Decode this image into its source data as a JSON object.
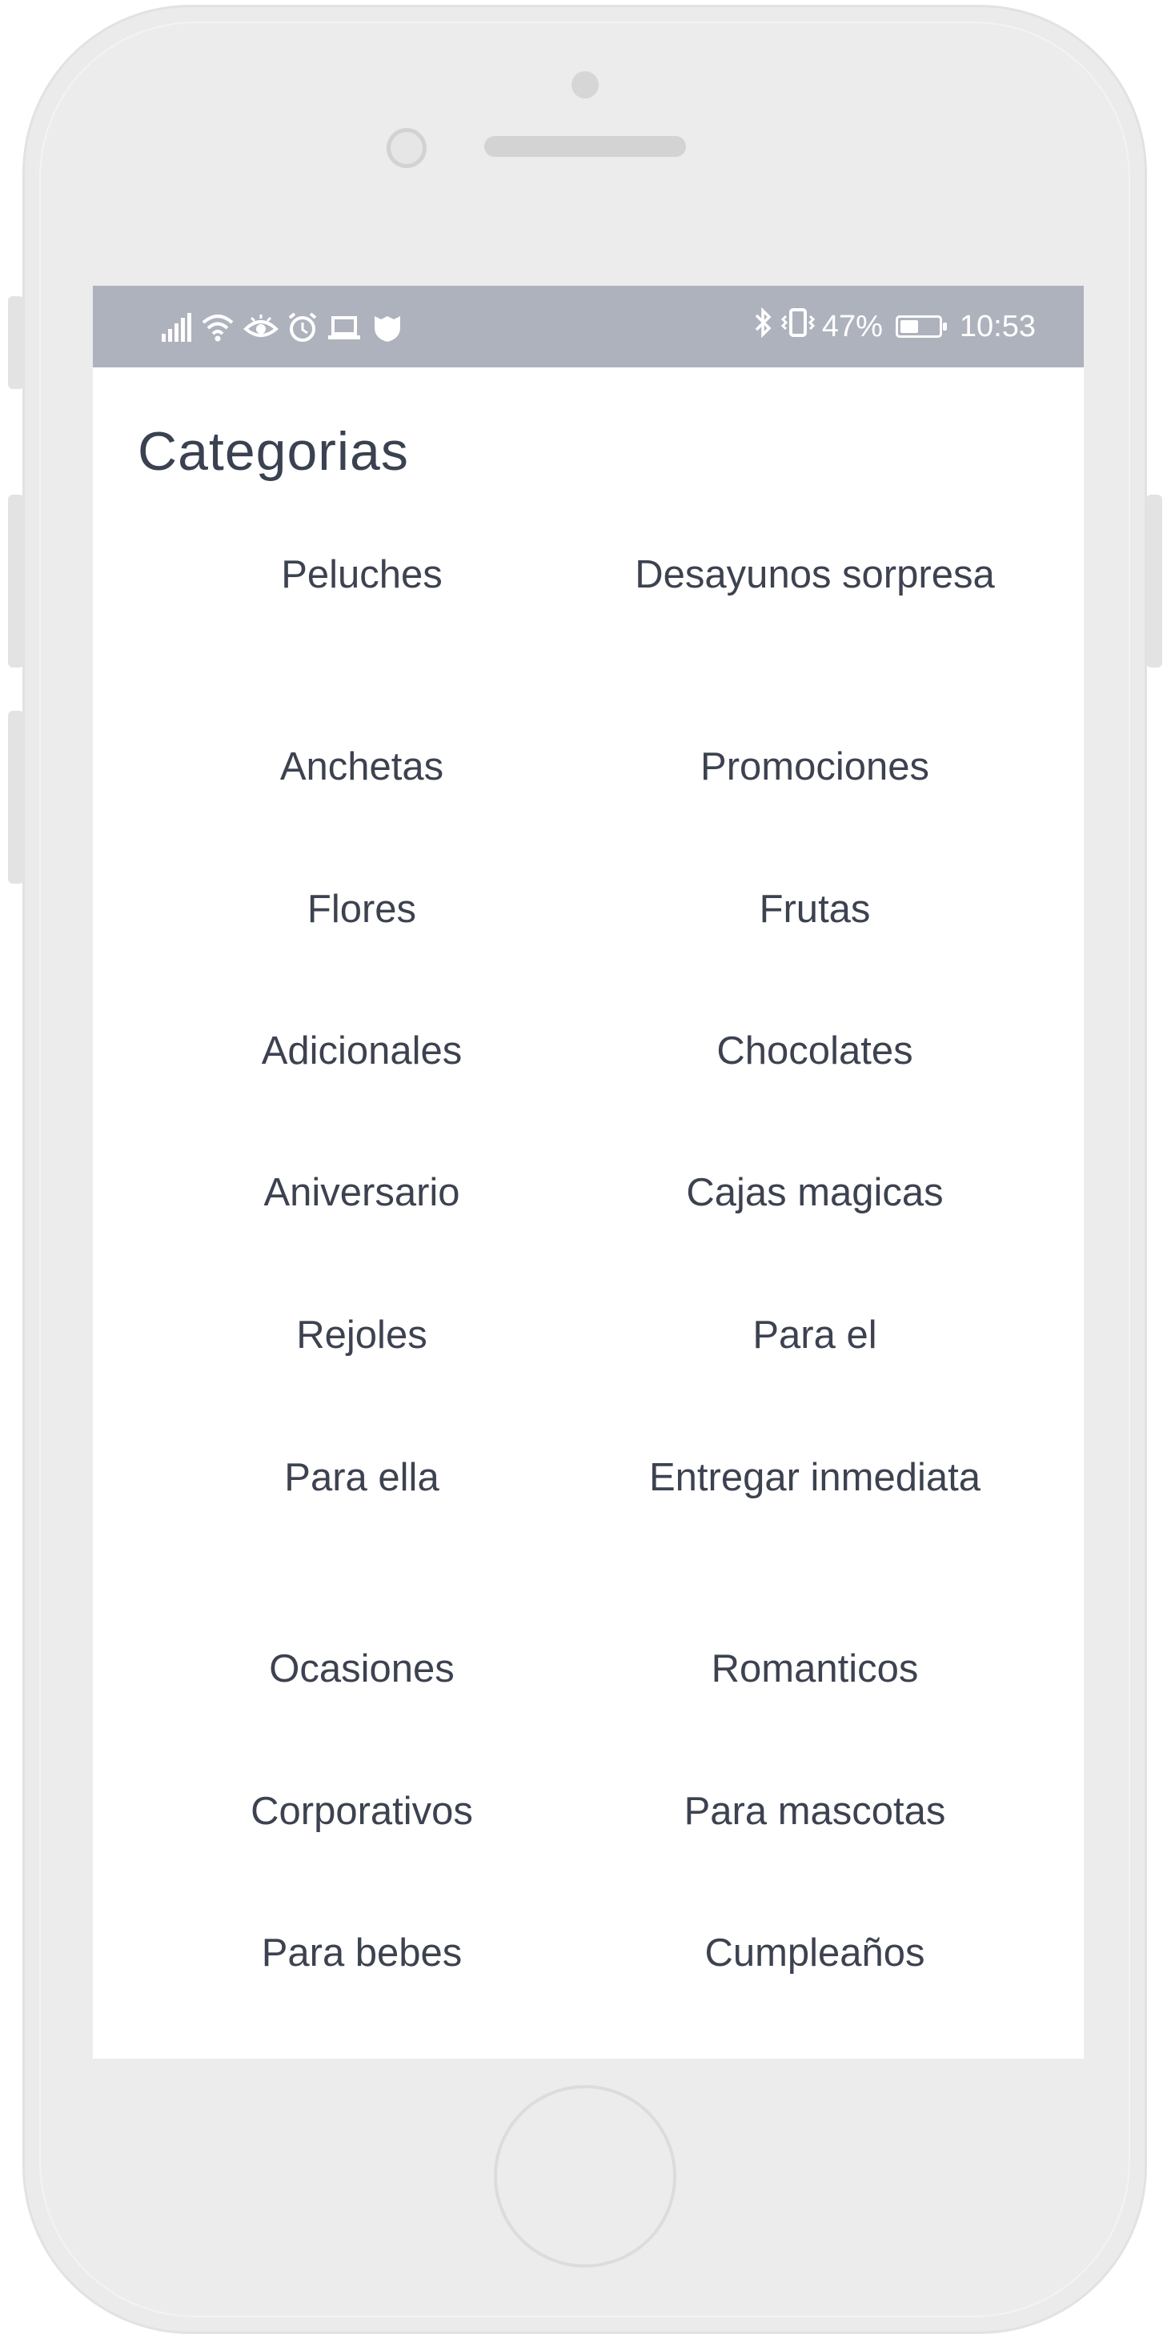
{
  "status_bar": {
    "battery_text": "47%",
    "time": "10:53",
    "left_icons": [
      "signal-icon",
      "wifi-icon",
      "eye-icon",
      "alarm-icon",
      "laptop-icon",
      "shield-icon"
    ],
    "right_icons": [
      "bluetooth-icon",
      "vibrate-icon",
      "battery-icon"
    ]
  },
  "page": {
    "title": "Categorias"
  },
  "categories": [
    "Peluches",
    "Desayunos sorpresa",
    "Anchetas",
    "Promociones",
    "Flores",
    "Frutas",
    "Adicionales",
    "Chocolates",
    "Aniversario",
    "Cajas magicas",
    "Rejoles",
    "Para el",
    "Para ella",
    "Entregar inmediata",
    "Ocasiones",
    "Romanticos",
    "Corporativos",
    "Para mascotas",
    "Para bebes",
    "Cumpleaños"
  ],
  "colors": {
    "status_bar": "#aeb2bd",
    "text": "#3d4250",
    "phone_frame": "#ebebeb"
  }
}
